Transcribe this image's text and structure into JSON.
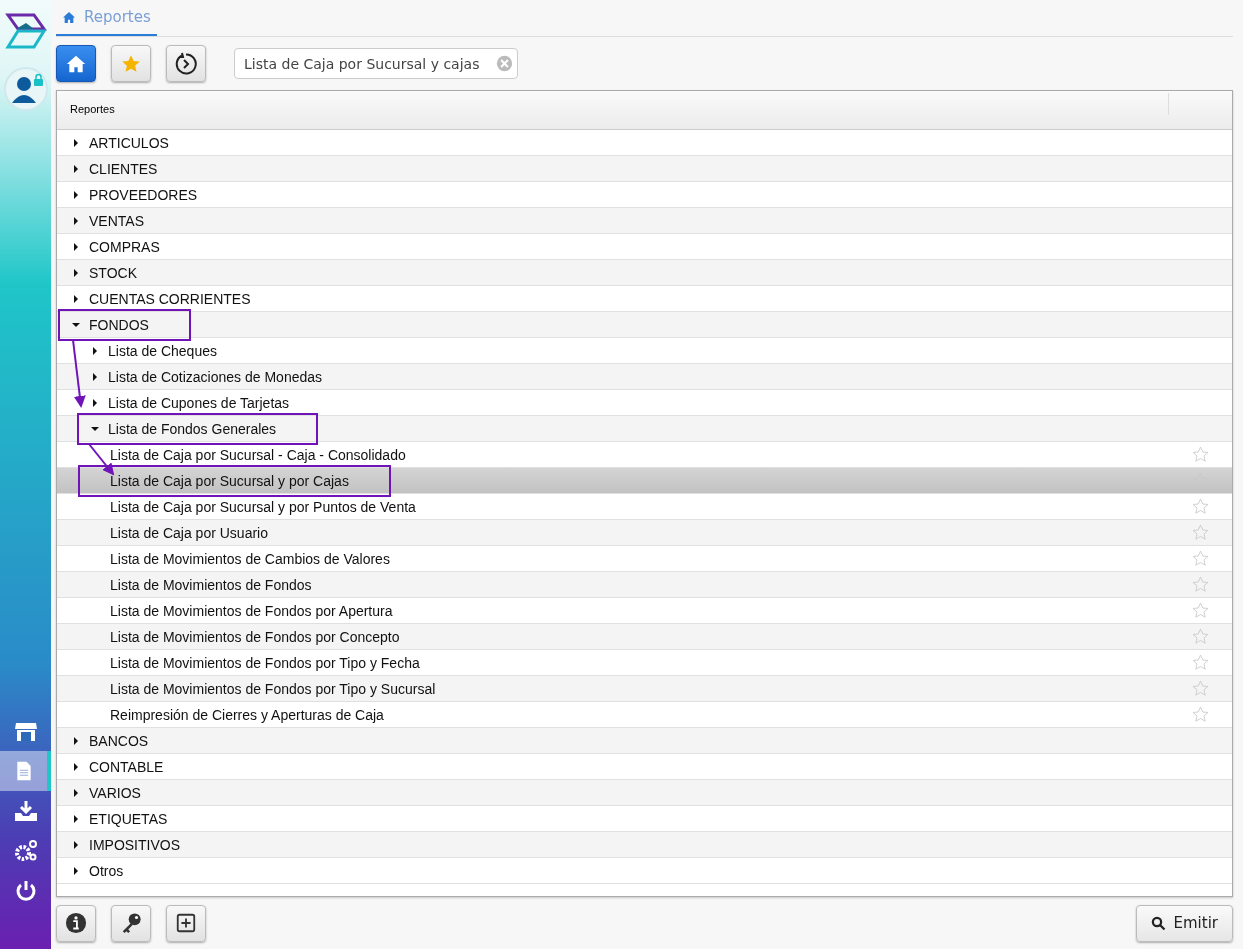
{
  "sidebar": {
    "items": [
      {
        "selected": false
      },
      {
        "selected": true
      },
      {
        "selected": false
      },
      {
        "selected": false
      },
      {
        "selected": false
      }
    ]
  },
  "tabs": [
    {
      "label": "Reportes",
      "selected": true
    }
  ],
  "toolbar": {
    "buttons": [
      {
        "selected": true
      },
      {
        "selected": false
      },
      {
        "selected": false
      }
    ],
    "search": {
      "value": "Lista de Caja por Sucursal y cajas"
    }
  },
  "table": {
    "columns": [
      "Reportes"
    ],
    "rows": [
      {
        "label": "ARTICULOS",
        "expanded": false,
        "annotated": false
      },
      {
        "label": "CLIENTES",
        "expanded": false,
        "annotated": false
      },
      {
        "label": "PROVEEDORES",
        "expanded": false,
        "annotated": false
      },
      {
        "label": "VENTAS",
        "expanded": false,
        "annotated": false
      },
      {
        "label": "COMPRAS",
        "expanded": false,
        "annotated": false
      },
      {
        "label": "STOCK",
        "expanded": false,
        "annotated": false
      },
      {
        "label": "CUENTAS CORRIENTES",
        "expanded": false,
        "annotated": false
      },
      {
        "label": "FONDOS",
        "expanded": true,
        "annotated": true,
        "children": [
          {
            "label": "Lista de Cheques",
            "expanded": false,
            "annotated": false
          },
          {
            "label": "Lista de Cotizaciones de Monedas",
            "expanded": false,
            "annotated": false
          },
          {
            "label": "Lista de Cupones de Tarjetas",
            "expanded": false,
            "annotated": false
          },
          {
            "label": "Lista de Fondos Generales",
            "expanded": true,
            "annotated": true,
            "children": [
              {
                "label": "Lista de Caja por Sucursal - Caja - Consolidado",
                "selected": false,
                "favorite": false,
                "annotated": false
              },
              {
                "label": "Lista de Caja por Sucursal y por Cajas",
                "selected": true,
                "favorite": false,
                "annotated": true
              },
              {
                "label": "Lista de Caja por Sucursal y por Puntos de Venta",
                "selected": false,
                "favorite": false,
                "annotated": false
              },
              {
                "label": "Lista de Caja por Usuario",
                "selected": false,
                "favorite": false,
                "annotated": false
              },
              {
                "label": "Lista de Movimientos de Cambios de Valores",
                "selected": false,
                "favorite": false,
                "annotated": false
              },
              {
                "label": "Lista de Movimientos de Fondos",
                "selected": false,
                "favorite": false,
                "annotated": false
              },
              {
                "label": "Lista de Movimientos de Fondos por Apertura",
                "selected": false,
                "favorite": false,
                "annotated": false
              },
              {
                "label": "Lista de Movimientos de Fondos por Concepto",
                "selected": false,
                "favorite": false,
                "annotated": false
              },
              {
                "label": "Lista de Movimientos de Fondos por Tipo y Fecha",
                "selected": false,
                "favorite": false,
                "annotated": false
              },
              {
                "label": "Lista de Movimientos de Fondos por Tipo y Sucursal",
                "selected": false,
                "favorite": false,
                "annotated": false
              },
              {
                "label": "Reimpresión de Cierres y Aperturas de Caja",
                "selected": false,
                "favorite": false,
                "annotated": false
              }
            ]
          }
        ]
      },
      {
        "label": "BANCOS",
        "expanded": false,
        "annotated": false
      },
      {
        "label": "CONTABLE",
        "expanded": false,
        "annotated": false
      },
      {
        "label": "VARIOS",
        "expanded": false,
        "annotated": false
      },
      {
        "label": "ETIQUETAS",
        "expanded": false,
        "annotated": false
      },
      {
        "label": "IMPOSITIVOS",
        "expanded": false,
        "annotated": false
      },
      {
        "label": "Otros",
        "expanded": false,
        "annotated": false
      }
    ]
  },
  "footer": {
    "action": {
      "label": "Emitir"
    }
  }
}
